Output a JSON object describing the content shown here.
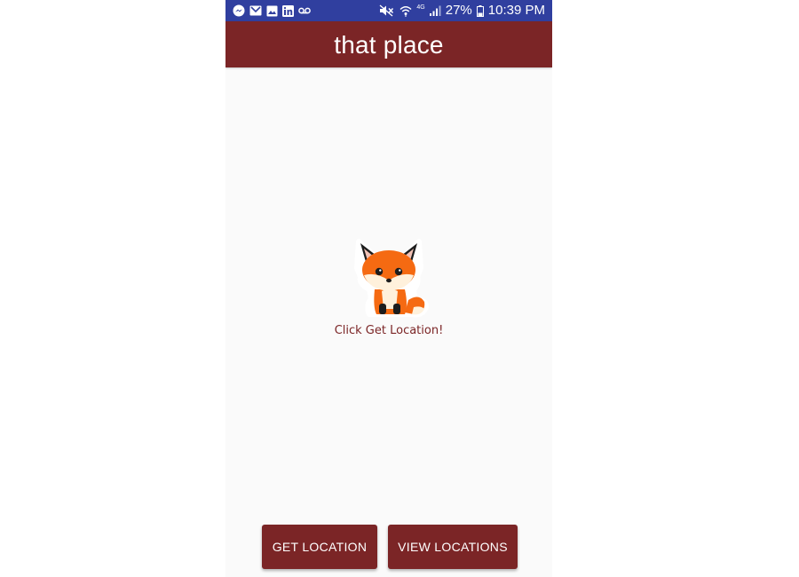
{
  "status_bar": {
    "left_icons": [
      "messenger-icon",
      "gmail-icon",
      "gallery-icon",
      "linkedin-icon",
      "voicemail-icon"
    ],
    "right_icons": [
      "mute-icon",
      "wifi-icon",
      "signal-icon",
      "battery-icon"
    ],
    "network_type": "4G",
    "battery_percent": "27%",
    "time": "10:39 PM",
    "color": "#303f9f"
  },
  "app_bar": {
    "title": "that place",
    "color": "#7b2526"
  },
  "main": {
    "image_icon": "fox-mascot",
    "hint": "Click Get Location!"
  },
  "buttons": {
    "get_location": "GET LOCATION",
    "view_locations": "VIEW LOCATIONS"
  }
}
